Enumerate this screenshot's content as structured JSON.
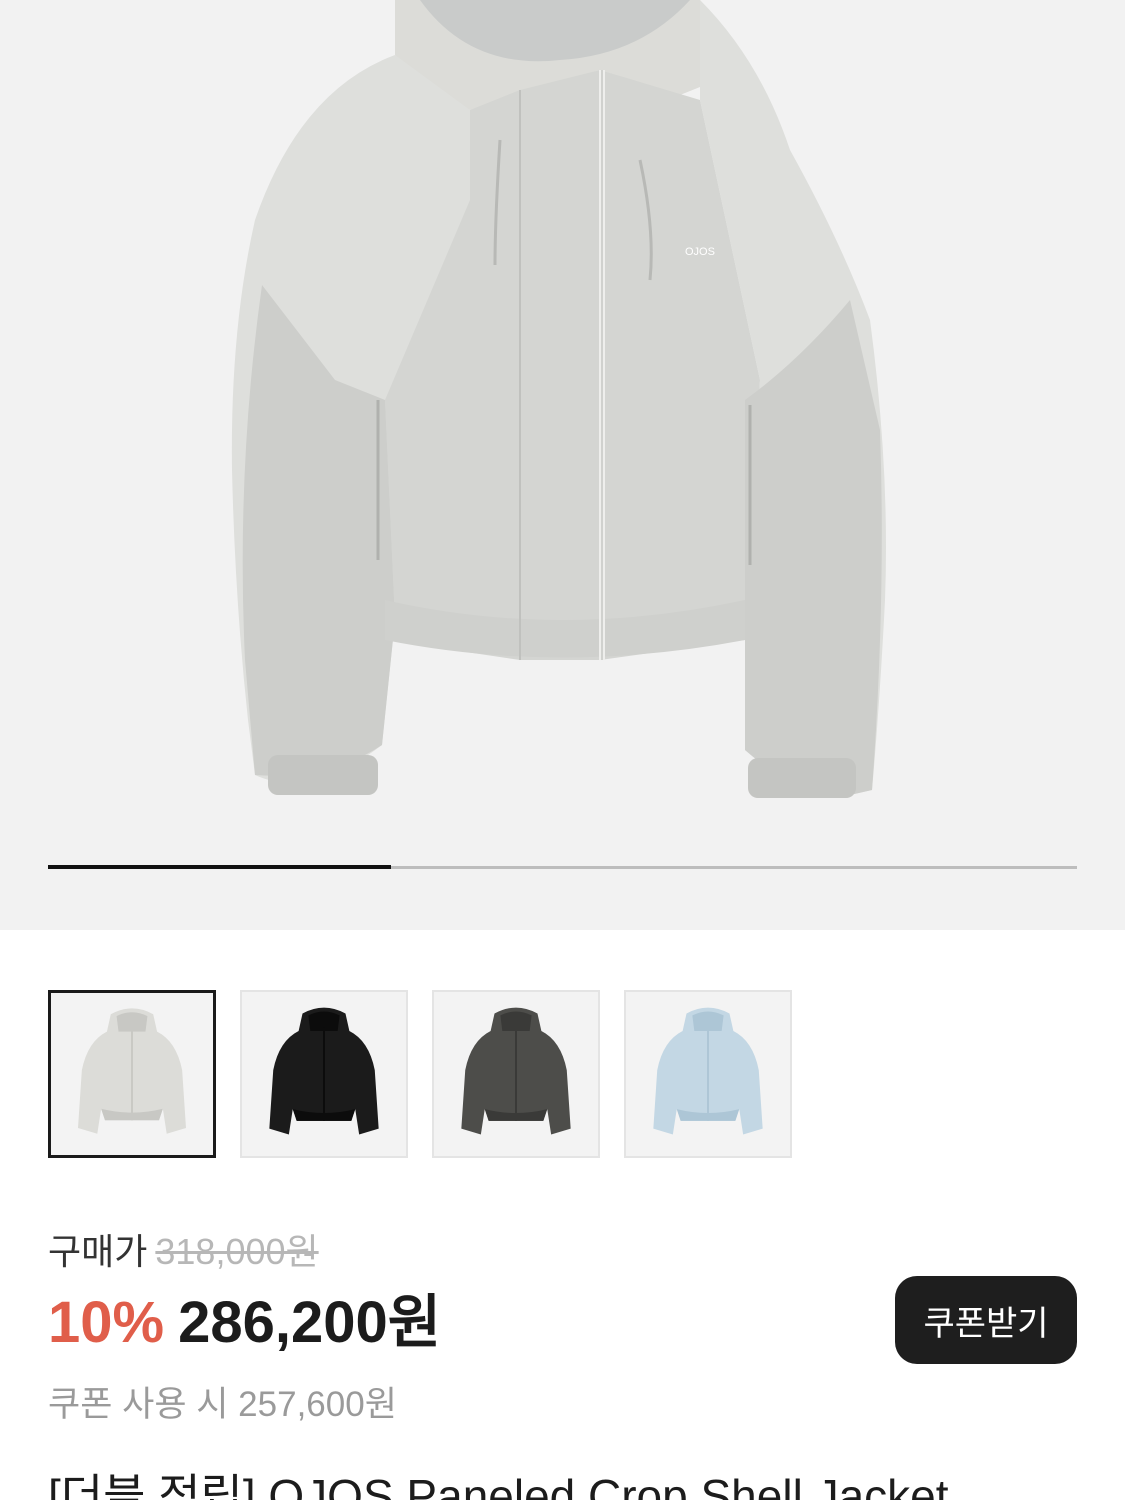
{
  "hero": {
    "image_alt": "panel-crop-shell-jacket-light-gray",
    "logo_text": "OJOS",
    "carousel_progress": 0.333
  },
  "thumbnails": [
    {
      "name": "thumb-light-gray",
      "color": "#dcdcd8",
      "shade": "#c8c8c4",
      "selected": true
    },
    {
      "name": "thumb-black",
      "color": "#1b1b1b",
      "shade": "#0c0c0c",
      "selected": false
    },
    {
      "name": "thumb-charcoal",
      "color": "#4d4d4a",
      "shade": "#3a3a38",
      "selected": false
    },
    {
      "name": "thumb-sky-blue",
      "color": "#c3d7e4",
      "shade": "#adc6d6",
      "selected": false
    }
  ],
  "price": {
    "purchase_label": "구매가",
    "original_price": "318,000원",
    "discount_rate": "10%",
    "sale_price": "286,200원",
    "coupon_price_text": "쿠폰 사용 시 257,600원",
    "discount_color": "#e05e4a"
  },
  "coupon_button": {
    "label": "쿠폰받기"
  },
  "product": {
    "title": "[더블 적립] OJOS Paneled Crop Shell Jacket"
  }
}
